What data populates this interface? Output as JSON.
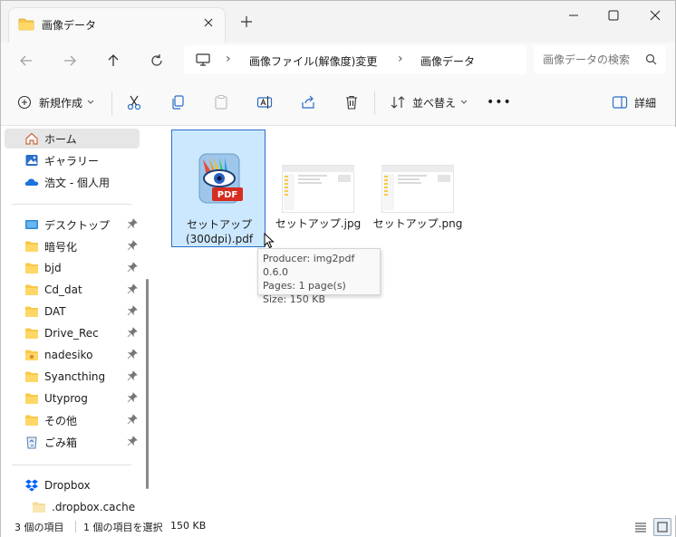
{
  "titlebar": {
    "tab_title": "画像データ",
    "tab_icon": "folder-icon",
    "new_tab_icon": "plus-icon",
    "controls": [
      "minimize-icon",
      "maximize-icon",
      "close-icon"
    ]
  },
  "navbar": {
    "back_icon": "arrow-left-icon",
    "forward_icon": "arrow-right-icon",
    "up_icon": "arrow-up-icon",
    "refresh_icon": "refresh-icon",
    "breadcrumbs": [
      "画像ファイル(解像度)変更",
      "画像データ"
    ],
    "search_placeholder": "画像データの検索"
  },
  "commandbar": {
    "new_label": "新規作成",
    "sort_label": "並べ替え",
    "details_label": "詳細",
    "more_label": "•••"
  },
  "sidebar": {
    "items": [
      {
        "label": "ホーム",
        "icon": "home-icon",
        "selected": true
      },
      {
        "label": "ギャラリー",
        "icon": "gallery-icon"
      },
      {
        "label": "浩文 - 個人用",
        "icon": "cloud-icon"
      },
      {
        "label": "デスクトップ",
        "icon": "desktop-icon",
        "pinned": true
      },
      {
        "label": "暗号化",
        "icon": "folder-icon",
        "pinned": true
      },
      {
        "label": "bjd",
        "icon": "folder-icon",
        "pinned": true
      },
      {
        "label": "Cd_dat",
        "icon": "folder-icon",
        "pinned": true
      },
      {
        "label": "DAT",
        "icon": "folder-icon",
        "pinned": true
      },
      {
        "label": "Drive_Rec",
        "icon": "folder-icon",
        "pinned": true
      },
      {
        "label": "nadesiko",
        "icon": "folder-icon",
        "pinned": true
      },
      {
        "label": "Syancthing",
        "icon": "folder-icon",
        "pinned": true
      },
      {
        "label": "Utyprog",
        "icon": "folder-icon",
        "pinned": true
      },
      {
        "label": "その他",
        "icon": "folder-icon",
        "pinned": true
      },
      {
        "label": "ごみ箱",
        "icon": "recycle-bin-icon",
        "pinned": true
      },
      {
        "label": "Dropbox",
        "icon": "dropbox-icon"
      },
      {
        "label": ".dropbox.cache",
        "icon": "folder-icon"
      }
    ]
  },
  "files": [
    {
      "name": "セットアップ(300dpi).pdf",
      "line1": "セットアップ",
      "line2": "(300dpi).pdf",
      "selected": true
    },
    {
      "name": "セットアップ.jpg"
    },
    {
      "name": "セットアップ.png"
    }
  ],
  "tooltip": {
    "producer": "Producer: img2pdf 0.6.0",
    "pages": "Pages: 1 page(s)",
    "size": "Size: 150 KB"
  },
  "status": {
    "item_count": "3 個の項目",
    "selected": "1 個の項目を選択",
    "selected_size": "150 KB"
  },
  "colors": {
    "accent": "#0067c0",
    "selection_bg": "#cce8ff",
    "folder": "#f8c94a"
  }
}
